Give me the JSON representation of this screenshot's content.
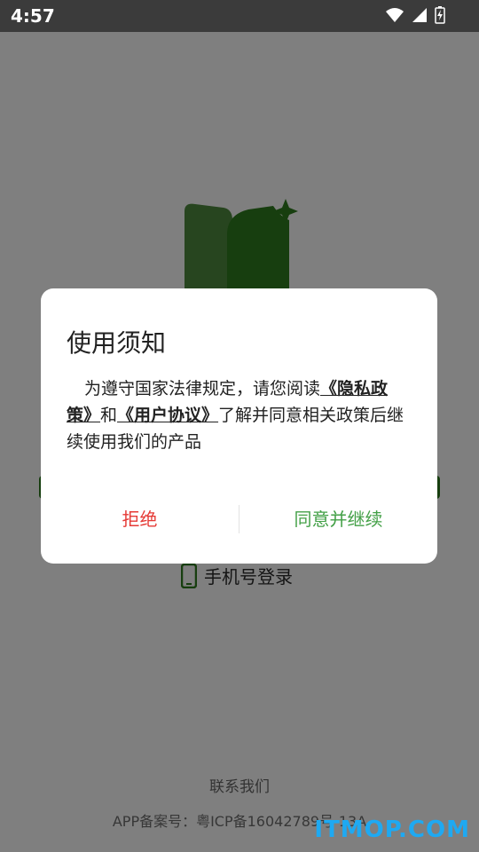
{
  "status_bar": {
    "time": "4:57"
  },
  "app": {
    "phone_login": "手机号登录",
    "contact": "联系我们",
    "icp": "APP备案号：粤ICP备16042789号-13A",
    "watermark": "ITMOP.COM"
  },
  "dialog": {
    "title": "使用须知",
    "body_prefix": "为遵守国家法律规定，请您阅读",
    "privacy_link": "《隐私政策》",
    "and": "和",
    "agreement_link": "《用户协议》",
    "body_suffix": "了解并同意相关政策后继续使用我们的产品",
    "reject_label": "拒绝",
    "agree_label": "同意并继续"
  },
  "colors": {
    "brand_green": "#2f7d1f",
    "reject": "#e53935",
    "agree": "#43a047",
    "watermark": "#1ea9f2"
  },
  "icons": [
    "wifi-icon",
    "signal-icon",
    "battery-charging-icon",
    "app-logo-icon",
    "phone-icon"
  ]
}
